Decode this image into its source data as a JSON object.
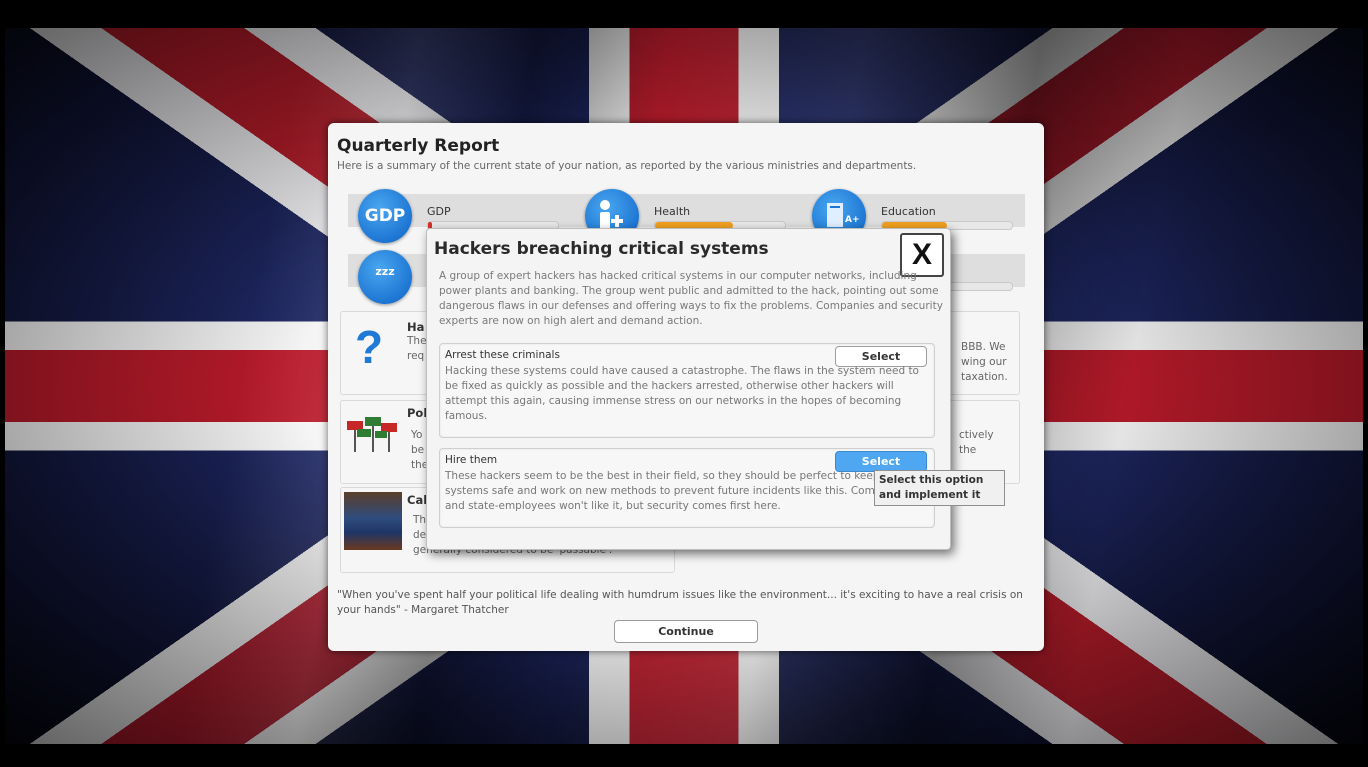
{
  "report": {
    "title": "Quarterly Report",
    "subtitle": "Here is a summary of the current state of your nation, as reported by the various ministries and departments.",
    "stats": [
      {
        "label": "GDP",
        "icon": "gdp-icon",
        "icon_text": "GDP",
        "level": 0.03,
        "color": "#d9302a"
      },
      {
        "label": "Health",
        "icon": "health-icon",
        "level": 0.6,
        "color": "#f0a020"
      },
      {
        "label": "Education",
        "icon": "education-icon",
        "level": 0.5,
        "color": "#f0a020"
      },
      {
        "label": "",
        "icon": "sleep-icon",
        "icon_text": "zzz"
      }
    ],
    "cards": [
      {
        "title": "Ha",
        "text_lines": [
          "The",
          "req"
        ]
      },
      {
        "title": "",
        "text_lines": [
          "BBB. We",
          "wing our",
          "taxation."
        ]
      },
      {
        "title": "Pol",
        "text_lines": [
          "Yo",
          "be",
          "the"
        ]
      },
      {
        "title": "",
        "text_lines": [
          "ctively",
          "the"
        ]
      },
      {
        "title": "Cal",
        "text_lines": [
          "Th",
          "de",
          "generally considered to be 'passable'."
        ]
      }
    ],
    "quote": "\"When you've spent half your political life dealing with humdrum issues like the environment... it's exciting to have a real crisis on your hands\" - Margaret Thatcher",
    "continue_label": "Continue"
  },
  "event": {
    "title": "Hackers breaching critical systems",
    "close_label": "X",
    "description": "A group of expert hackers has hacked critical systems in our computer networks, including power plants and banking. The group went public and admitted to the hack, pointing out some dangerous flaws in our defenses and offering ways to fix the problems. Companies and security experts are now on high alert and demand action.",
    "options": [
      {
        "title": "Arrest these criminals",
        "select_label": "Select",
        "text": "Hacking these systems could have caused a catastrophe. The flaws in the system need to be fixed as quickly as possible and the hackers arrested, otherwise other hackers will attempt this again, causing immense stress on our networks in the hopes of becoming famous."
      },
      {
        "title": "Hire them",
        "select_label": "Select",
        "text": "These hackers seem to be the best in their field, so they should be perfect to keep our systems safe and work on new methods to prevent future incidents like this. Companies and state-employees won't like it, but security comes first here."
      }
    ]
  },
  "tooltip": {
    "text": "Select this option and implement it"
  }
}
